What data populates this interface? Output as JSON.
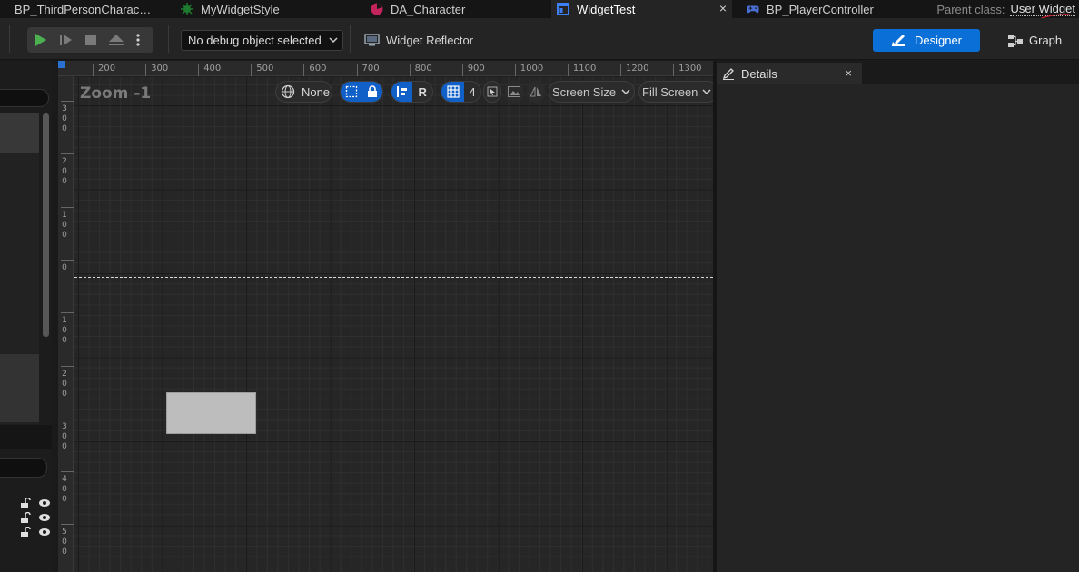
{
  "tabs": [
    {
      "label": "BP_ThirdPersonCharac…",
      "icon": "blueprint-character-icon",
      "active": false
    },
    {
      "label": "MyWidgetStyle",
      "icon": "widget-style-icon",
      "active": false
    },
    {
      "label": "DA_Character",
      "icon": "data-asset-icon",
      "active": false
    },
    {
      "label": "WidgetTest",
      "icon": "widget-blueprint-icon",
      "active": true,
      "close": "×"
    },
    {
      "label": "BP_PlayerController",
      "icon": "gamepad-icon",
      "active": false
    }
  ],
  "parent_class": {
    "label": "Parent class:",
    "value": "User Widget"
  },
  "toolbar": {
    "debug_object": "No debug object selected",
    "widget_reflector": "Widget Reflector",
    "designer": "Designer",
    "graph": "Graph"
  },
  "canvas": {
    "zoom": "Zoom -1",
    "ruler_top": [
      "200",
      "300",
      "400",
      "500",
      "600",
      "700",
      "800",
      "900",
      "1000",
      "1100",
      "1200",
      "1300"
    ],
    "ruler_left": [
      {
        "digits": [
          "3",
          "0",
          "0"
        ]
      },
      {
        "digits": [
          "2",
          "0",
          "0"
        ]
      },
      {
        "digits": [
          "1",
          "0",
          "0"
        ]
      },
      {
        "digits": [
          "0"
        ]
      },
      {
        "digits": [
          "1",
          "0",
          "0"
        ]
      },
      {
        "digits": [
          "2",
          "0",
          "0"
        ]
      },
      {
        "digits": [
          "3",
          "0",
          "0"
        ]
      },
      {
        "digits": [
          "4",
          "0",
          "0"
        ]
      },
      {
        "digits": [
          "5",
          "0",
          "0"
        ]
      }
    ],
    "toolbar": {
      "localization": "None",
      "respect_locks": "R",
      "grid_snap": "4",
      "screen_size": "Screen Size",
      "fill_mode": "Fill Screen"
    }
  },
  "details": {
    "title": "Details",
    "close": "×"
  },
  "colors": {
    "accent": "#0a6fd6",
    "tab_active_icon": "#3d7ff5",
    "play_green": "#4caf50"
  }
}
